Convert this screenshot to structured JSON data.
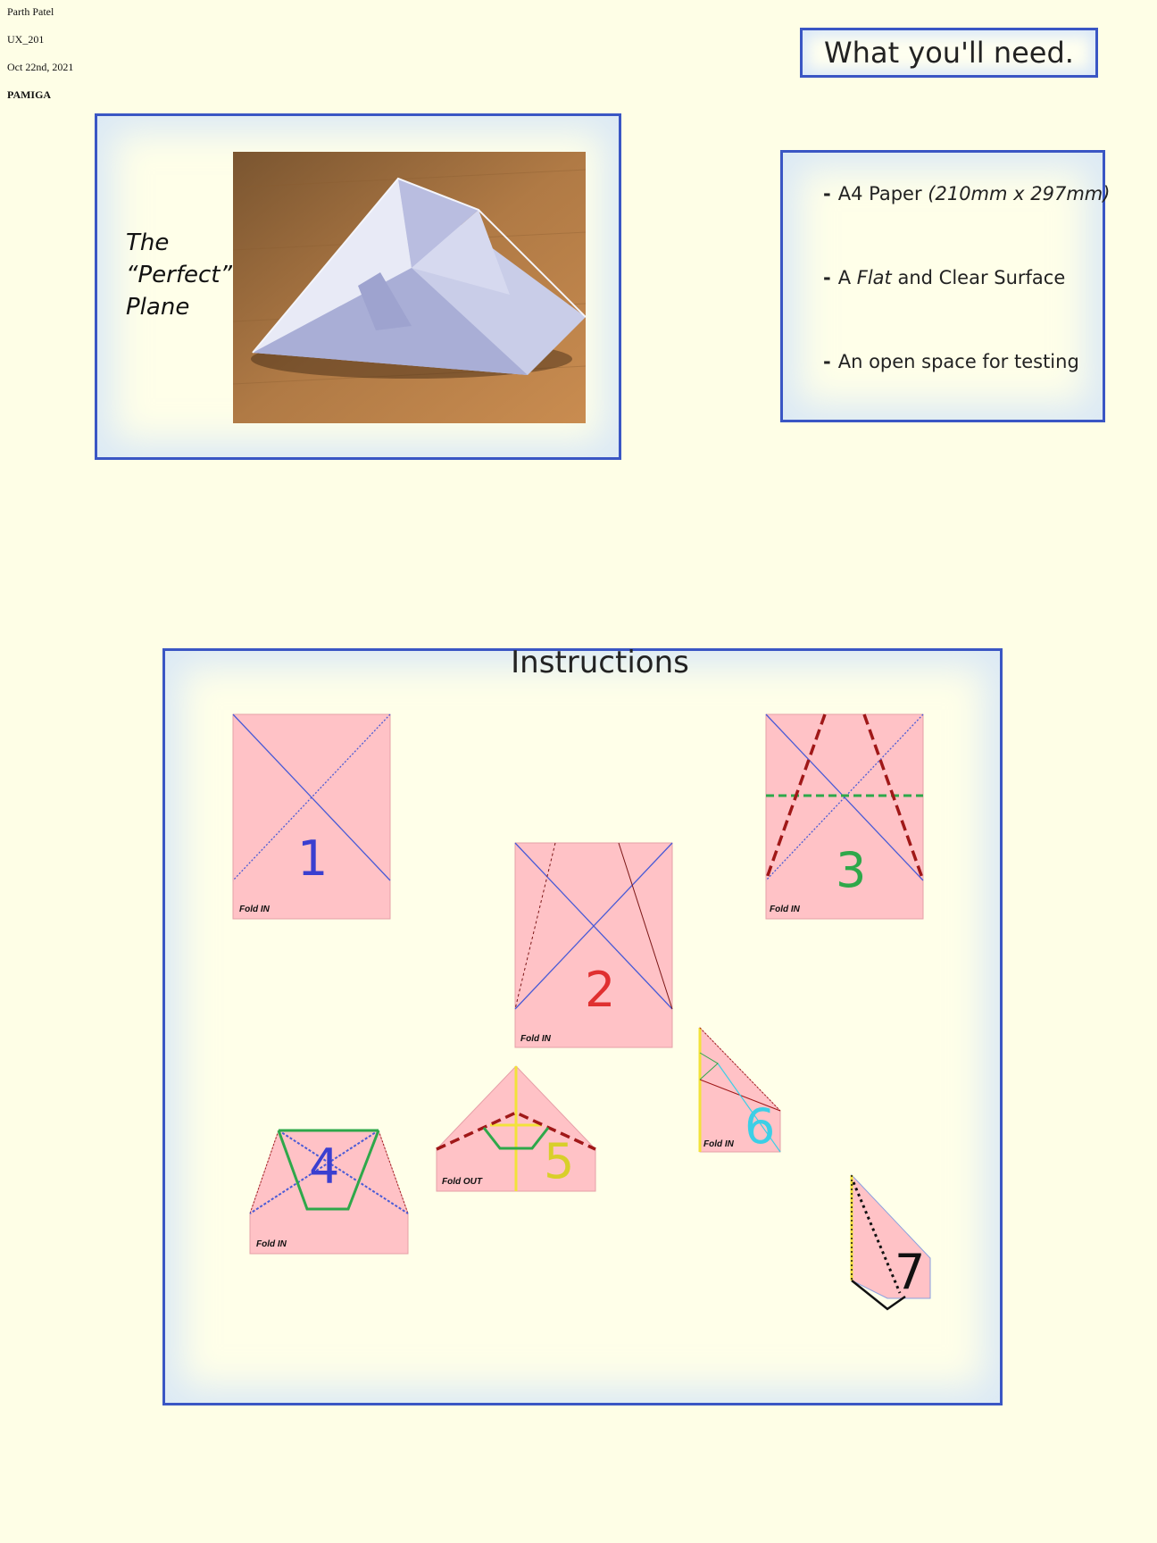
{
  "header": {
    "author": "Parth Patel",
    "course": "UX_201",
    "date": "Oct 22nd, 2021",
    "group": "PAMIGA"
  },
  "hero": {
    "title_line1": "The",
    "title_line2": "“Perfect”",
    "title_line3": "Plane",
    "photo_icon": "paper-airplane-photo"
  },
  "needs": {
    "heading": "What you'll need.",
    "items": [
      {
        "dash": "-",
        "text": "A4 Paper ",
        "italic": "(210mm x 297mm)",
        "suffix": ""
      },
      {
        "dash": "-",
        "text": "A ",
        "italic": "Flat",
        "suffix": " and Clear Surface"
      },
      {
        "dash": "-",
        "text": "An open space for testing",
        "italic": "",
        "suffix": ""
      }
    ]
  },
  "instructions": {
    "heading": "Instructions",
    "steps": [
      {
        "number": "1",
        "label": "Fold IN",
        "color": "#3a3fd0"
      },
      {
        "number": "2",
        "label": "Fold IN",
        "color": "#e03030"
      },
      {
        "number": "3",
        "label": "Fold IN",
        "color": "#2ea84a"
      },
      {
        "number": "4",
        "label": "Fold IN",
        "color": "#3a3fd0"
      },
      {
        "number": "5",
        "label": "Fold OUT",
        "color": "#d8cf2a"
      },
      {
        "number": "6",
        "label": "Fold IN",
        "color": "#3ccfe6"
      },
      {
        "number": "7",
        "label": "",
        "color": "#111111"
      }
    ]
  },
  "colors": {
    "background": "#fefee6",
    "frame": "#3a56c4",
    "paper": "#ffc2c6",
    "valley_fold": "#4a5bd6",
    "mountain_fold": "#a01818",
    "center_fold": "#2ea84a",
    "yellow_fold": "#f2e23a"
  }
}
